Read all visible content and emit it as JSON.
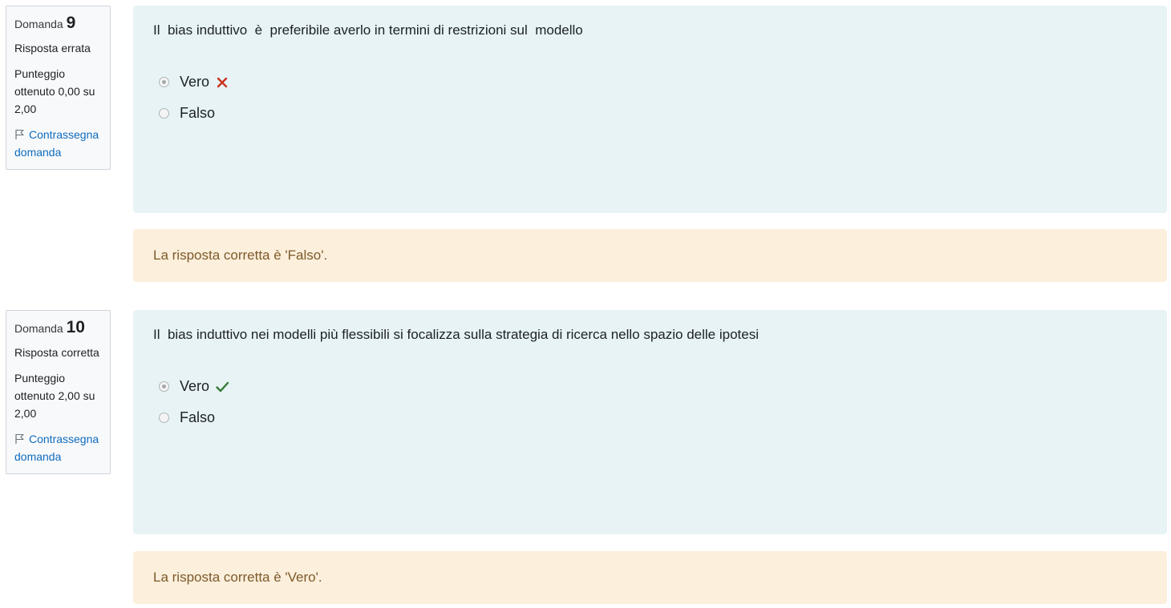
{
  "questions": [
    {
      "label": "Domanda",
      "number": "9",
      "state": "Risposta errata",
      "grade": "Punteggio ottenuto 0,00 su 2,00",
      "flag_label": "Contrassegna domanda",
      "text": "Il  bias induttivo  è  preferibile averlo in termini di restrizioni sul  modello",
      "answers": [
        {
          "label": "Vero",
          "selected": true,
          "mark": "incorrect-icon"
        },
        {
          "label": "Falso",
          "selected": false,
          "mark": ""
        }
      ],
      "feedback": "La risposta corretta è 'Falso'."
    },
    {
      "label": "Domanda",
      "number": "10",
      "state": "Risposta corretta",
      "grade": "Punteggio ottenuto 2,00 su 2,00",
      "flag_label": "Contrassegna domanda",
      "text": "Il  bias induttivo nei modelli più flessibili si focalizza sulla strategia di ricerca nello spazio delle ipotesi",
      "answers": [
        {
          "label": "Vero",
          "selected": true,
          "mark": "correct-icon"
        },
        {
          "label": "Falso",
          "selected": false,
          "mark": ""
        }
      ],
      "feedback": "La risposta corretta è 'Vero'."
    }
  ],
  "colors": {
    "incorrect": "#ca3120",
    "correct": "#357a32",
    "link": "#0f6cbf",
    "formulation_bg": "#e7f3f5",
    "feedback_bg": "#fcefdc",
    "feedback_text": "#7d5a29"
  }
}
